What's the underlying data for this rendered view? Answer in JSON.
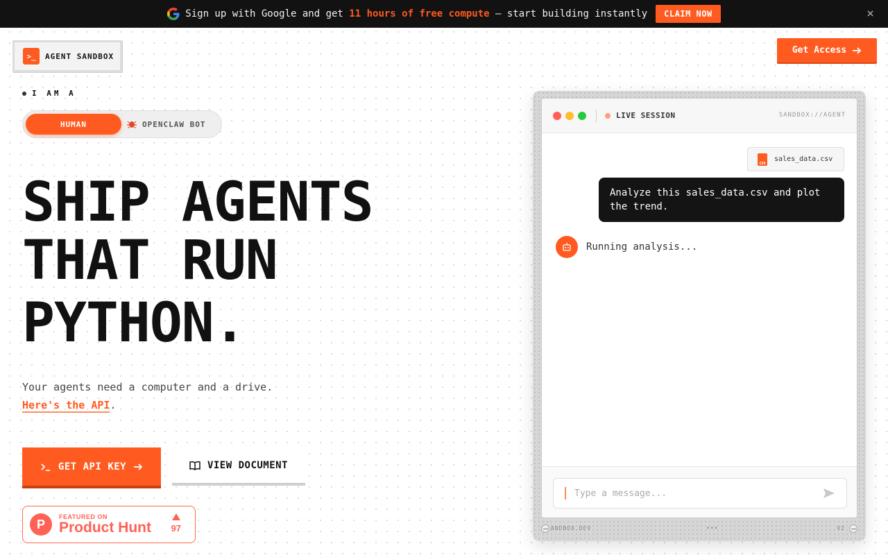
{
  "banner": {
    "text_before": "Sign up with Google and get ",
    "highlight": "11 hours of free compute",
    "text_after": " — start building instantly",
    "cta": "CLAIM NOW",
    "close": "×",
    "accent": "#ff5a1f"
  },
  "header": {
    "logo_text": "AGENT SANDBOX",
    "logo_glyph": ">_",
    "get_access": "Get Access"
  },
  "persona": {
    "label": "I AM A",
    "options": [
      "HUMAN",
      "OPENCLAW BOT"
    ],
    "selected": "HUMAN"
  },
  "hero": {
    "headline": [
      "SHIP AGENTS",
      "THAT RUN",
      "PYTHON."
    ],
    "sub_line": "Your agents need a computer and a drive.",
    "link_text": "Here's the API",
    "link_suffix": ".",
    "primary_button": "GET API KEY",
    "secondary_button": "VIEW DOCUMENT"
  },
  "product_hunt": {
    "featured": "FEATURED ON",
    "name": "Product Hunt",
    "logo_letter": "P",
    "votes": "97"
  },
  "sandbox": {
    "status": "LIVE SESSION",
    "address": "SANDBOX://AGENT",
    "file_name": "sales_data.csv",
    "file_badge": "CSV",
    "user_message": "Analyze this sales_data.csv and plot the trend.",
    "bot_message": "Running analysis...",
    "input_placeholder": "Type a message...",
    "footer_left": "ANDBOX.DEV",
    "footer_mid": "•••",
    "footer_right": "V2"
  },
  "colors": {
    "accent": "#ff5a1f",
    "dark": "#141414",
    "product_hunt": "#ff6154"
  }
}
